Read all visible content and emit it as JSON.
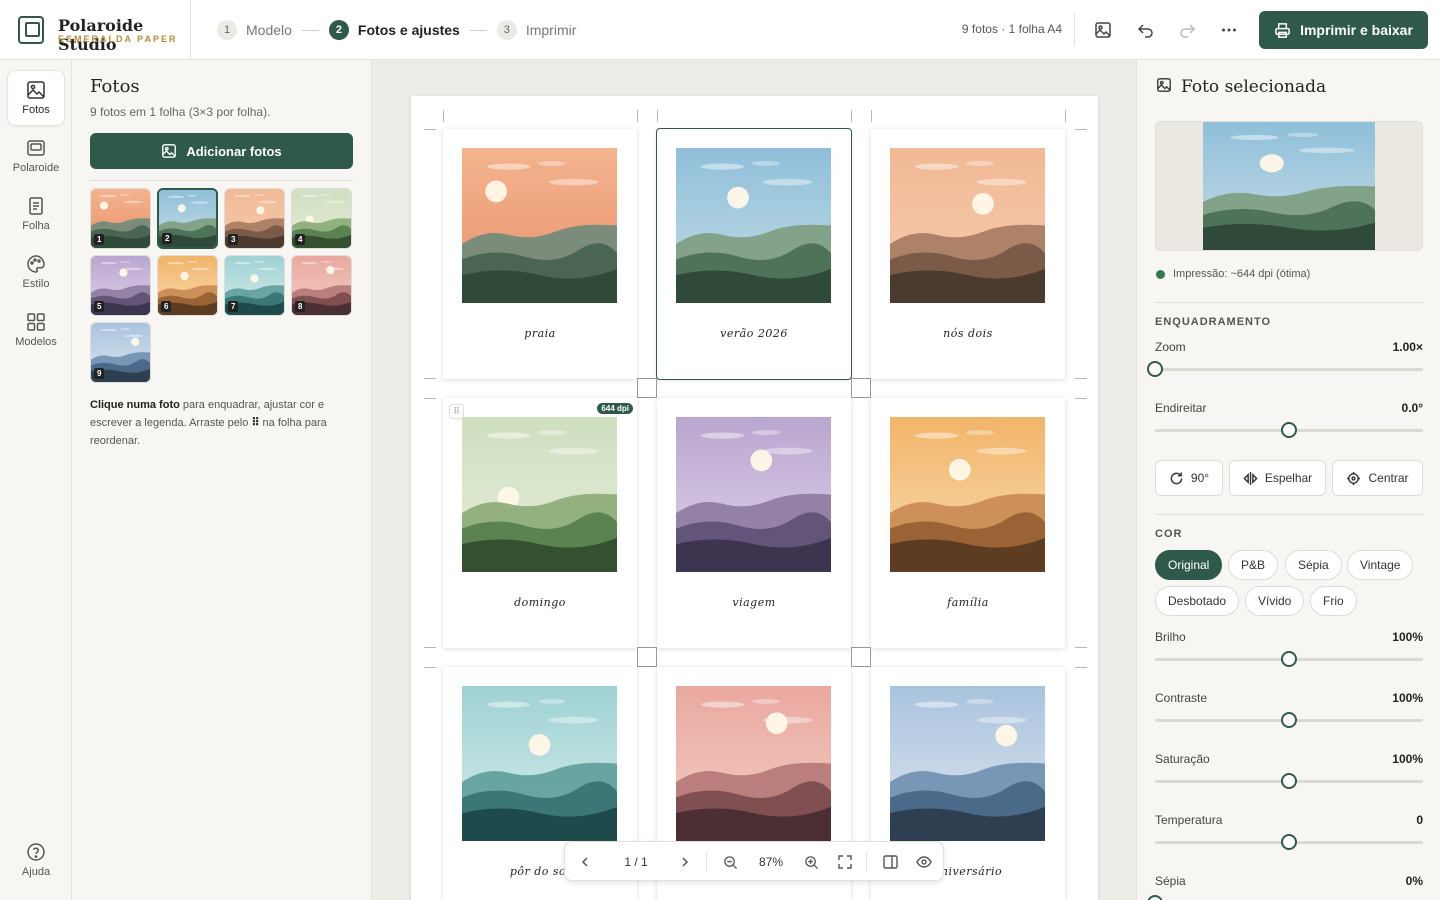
{
  "app": {
    "name": "Polaroide Studio",
    "subtitle": "ESMERALDA PAPER"
  },
  "steps": [
    {
      "num": "1",
      "label": "Modelo"
    },
    {
      "num": "2",
      "label": "Fotos e ajustes"
    },
    {
      "num": "3",
      "label": "Imprimir"
    }
  ],
  "header": {
    "meta": "9 fotos · 1 folha A4",
    "print_label": "Imprimir e baixar"
  },
  "rail": [
    {
      "label": "Fotos",
      "icon": "image-icon"
    },
    {
      "label": "Polaroide",
      "icon": "polaroid-icon"
    },
    {
      "label": "Folha",
      "icon": "sheet-icon"
    },
    {
      "label": "Estilo",
      "icon": "palette-icon"
    },
    {
      "label": "Modelos",
      "icon": "grid-icon"
    },
    {
      "label": "Ajuda",
      "icon": "help-icon"
    }
  ],
  "left": {
    "title": "Fotos",
    "subtitle": "9 fotos em 1 folha (3×3 por folha).",
    "add_label": "Adicionar fotos",
    "thumbs": [
      "1",
      "2",
      "3",
      "4",
      "5",
      "6",
      "7",
      "8",
      "9"
    ],
    "hint_bold": "Clique numa foto",
    "hint_1": " para enquadrar, ajustar cor e escrever a legenda. Arraste pelo ",
    "hint_glyph": "⠿",
    "hint_2": " na folha para reordenar."
  },
  "cards": [
    {
      "caption": "praia"
    },
    {
      "caption": "verão 2026"
    },
    {
      "caption": "nós dois"
    },
    {
      "caption": "domingo",
      "dpi": "644 dpi"
    },
    {
      "caption": "viagem"
    },
    {
      "caption": "família"
    },
    {
      "caption": "pôr do sol"
    },
    {
      "caption": ""
    },
    {
      "caption": "aniversário"
    }
  ],
  "zoombar": {
    "page": "1 / 1",
    "zoom": "87%"
  },
  "right": {
    "title": "Foto selecionada",
    "dpi_note": "Impressão: ~644 dpi (ótima)",
    "frame_section": "ENQUADRAMENTO",
    "zoom": {
      "label": "Zoom",
      "value": "1.00×",
      "level": 0.0
    },
    "straighten": {
      "label": "Endireitar",
      "value": "0.0°",
      "level": 0.5
    },
    "btn_rotate": "90°",
    "btn_mirror": "Espelhar",
    "btn_center": "Centrar",
    "color_section": "COR",
    "filters": [
      "Original",
      "P&B",
      "Sépia",
      "Vintage",
      "Desbotado",
      "Vívido",
      "Frio"
    ],
    "filter_active": "Original",
    "brightness": {
      "label": "Brilho",
      "value": "100%",
      "level": 0.5
    },
    "contrast": {
      "label": "Contraste",
      "value": "100%",
      "level": 0.5
    },
    "saturation": {
      "label": "Saturação",
      "value": "100%",
      "level": 0.5
    },
    "temperature": {
      "label": "Temperatura",
      "value": "0",
      "level": 0.5
    },
    "sepia": {
      "label": "Sépia",
      "value": "0%",
      "level": 0.0
    }
  },
  "palettes": [
    {
      "sky1": "#f3b48e",
      "sky2": "#e8906c",
      "m1": "#6f8a7a",
      "m2": "#4a6652",
      "m3": "#2f4a38"
    },
    {
      "sky1": "#8fbfd9",
      "sky2": "#c6dde6",
      "m1": "#7d9c80",
      "m2": "#4f7358",
      "m3": "#2f4a38"
    },
    {
      "sky1": "#f2b995",
      "sky2": "#f5cbb0",
      "m1": "#a57b62",
      "m2": "#7b5a47",
      "m3": "#4b3a2e"
    },
    {
      "sky1": "#cfdfc0",
      "sky2": "#e6edd8",
      "m1": "#8bab75",
      "m2": "#5d8251",
      "m3": "#34502f"
    },
    {
      "sky1": "#b9a6d0",
      "sky2": "#e0d3ea",
      "m1": "#8d7ba0",
      "m2": "#63557a",
      "m3": "#3d3450"
    },
    {
      "sky1": "#f2b46a",
      "sky2": "#f8dcae",
      "m1": "#c88a52",
      "m2": "#9a6336",
      "m3": "#5d3d22"
    },
    {
      "sky1": "#9fd2d4",
      "sky2": "#d6ecea",
      "m1": "#5e9d9b",
      "m2": "#3a7776",
      "m3": "#1f4a4c"
    },
    {
      "sky1": "#e9a8a0",
      "sky2": "#f4cfc6",
      "m1": "#b47876",
      "m2": "#7f4f51",
      "m3": "#4c2f33"
    },
    {
      "sky1": "#a9c3de",
      "sky2": "#dde6ee",
      "m1": "#6f8fb0",
      "m2": "#4a6a8a",
      "m3": "#2e3f52"
    }
  ]
}
